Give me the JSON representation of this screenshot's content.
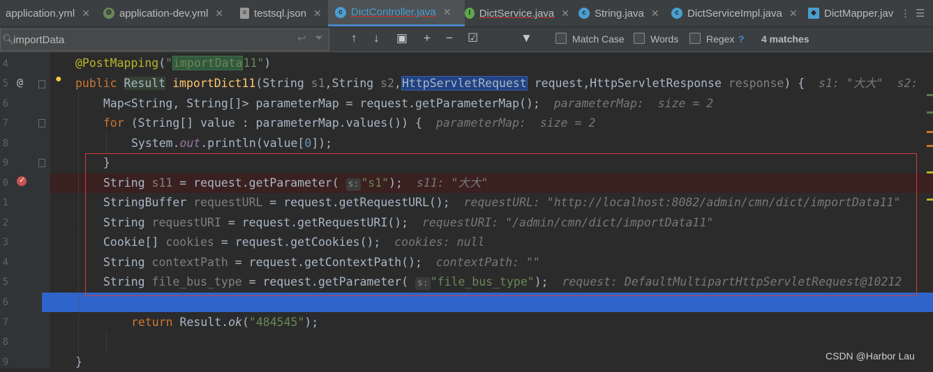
{
  "tabs": [
    {
      "label": "application.yml",
      "icon": "yml-icon",
      "color": "#6a8759"
    },
    {
      "label": "application-dev.yml",
      "icon": "yml-leaf-icon",
      "color": "#6a8759"
    },
    {
      "label": "testsql.json",
      "icon": "json-icon",
      "color": "#999999"
    },
    {
      "label": "DictController.java",
      "icon": "class-icon",
      "color": "#4a9fd0",
      "active": true
    },
    {
      "label": "DictService.java",
      "icon": "interface-icon",
      "color": "#5fa84b"
    },
    {
      "label": "String.java",
      "icon": "class-icon",
      "color": "#4a9fd0"
    },
    {
      "label": "DictServiceImpl.java",
      "icon": "class-icon",
      "color": "#4a9fd0"
    },
    {
      "label": "DictMapper.jav",
      "icon": "mapper-icon",
      "color": "#4a9fd0"
    }
  ],
  "find": {
    "query": "importData",
    "match_case": "Match Case",
    "words": "Words",
    "regex": "Regex",
    "help": "?",
    "matches": "4 matches"
  },
  "lines": [
    {
      "num": "4",
      "text": "    @PostMapping(\"importData11\")"
    },
    {
      "num": "5",
      "text": "public Result importDict11(String s1,String s2,HttpServletRequest request,HttpServletResponse response) {  s1: \"大大\"  s2:"
    },
    {
      "num": "6",
      "text": "Map<String, String[]> parameterMap = request.getParameterMap();  parameterMap:  size = 2"
    },
    {
      "num": "7",
      "text": "for (String[] value : parameterMap.values()) {  parameterMap:  size = 2"
    },
    {
      "num": "8",
      "text": "System.out.println(value[0]);"
    },
    {
      "num": "9",
      "text": "}"
    },
    {
      "num": "0",
      "text": "String s11 = request.getParameter( s: \"s1\");  s11: \"大大\""
    },
    {
      "num": "1",
      "text": "StringBuffer requestURL = request.getRequestURL();  requestURL: \"http://localhost:8082/admin/cmn/dict/importData11\""
    },
    {
      "num": "2",
      "text": "String requestURI = request.getRequestURI();  requestURI: \"/admin/cmn/dict/importData11\""
    },
    {
      "num": "3",
      "text": "Cookie[] cookies = request.getCookies();  cookies: null"
    },
    {
      "num": "4",
      "text": "String contextPath = request.getContextPath();  contextPath: \"\""
    },
    {
      "num": "5",
      "text": "String file_bus_type = request.getParameter( s: \"file_bus_type\");  request: DefaultMultipartHttpServletRequest@10212"
    },
    {
      "num": "6",
      "text": ""
    },
    {
      "num": "7",
      "text": "return Result.ok(\"484545\");"
    },
    {
      "num": "8",
      "text": ""
    },
    {
      "num": "9",
      "text": "}"
    }
  ],
  "watermark": "CSDN @Harbor Lau",
  "colors": {
    "accent": "#4a88c7",
    "highlight": "#2f65ca",
    "breakpoint": "#c75450",
    "box": "#d53b3b"
  }
}
